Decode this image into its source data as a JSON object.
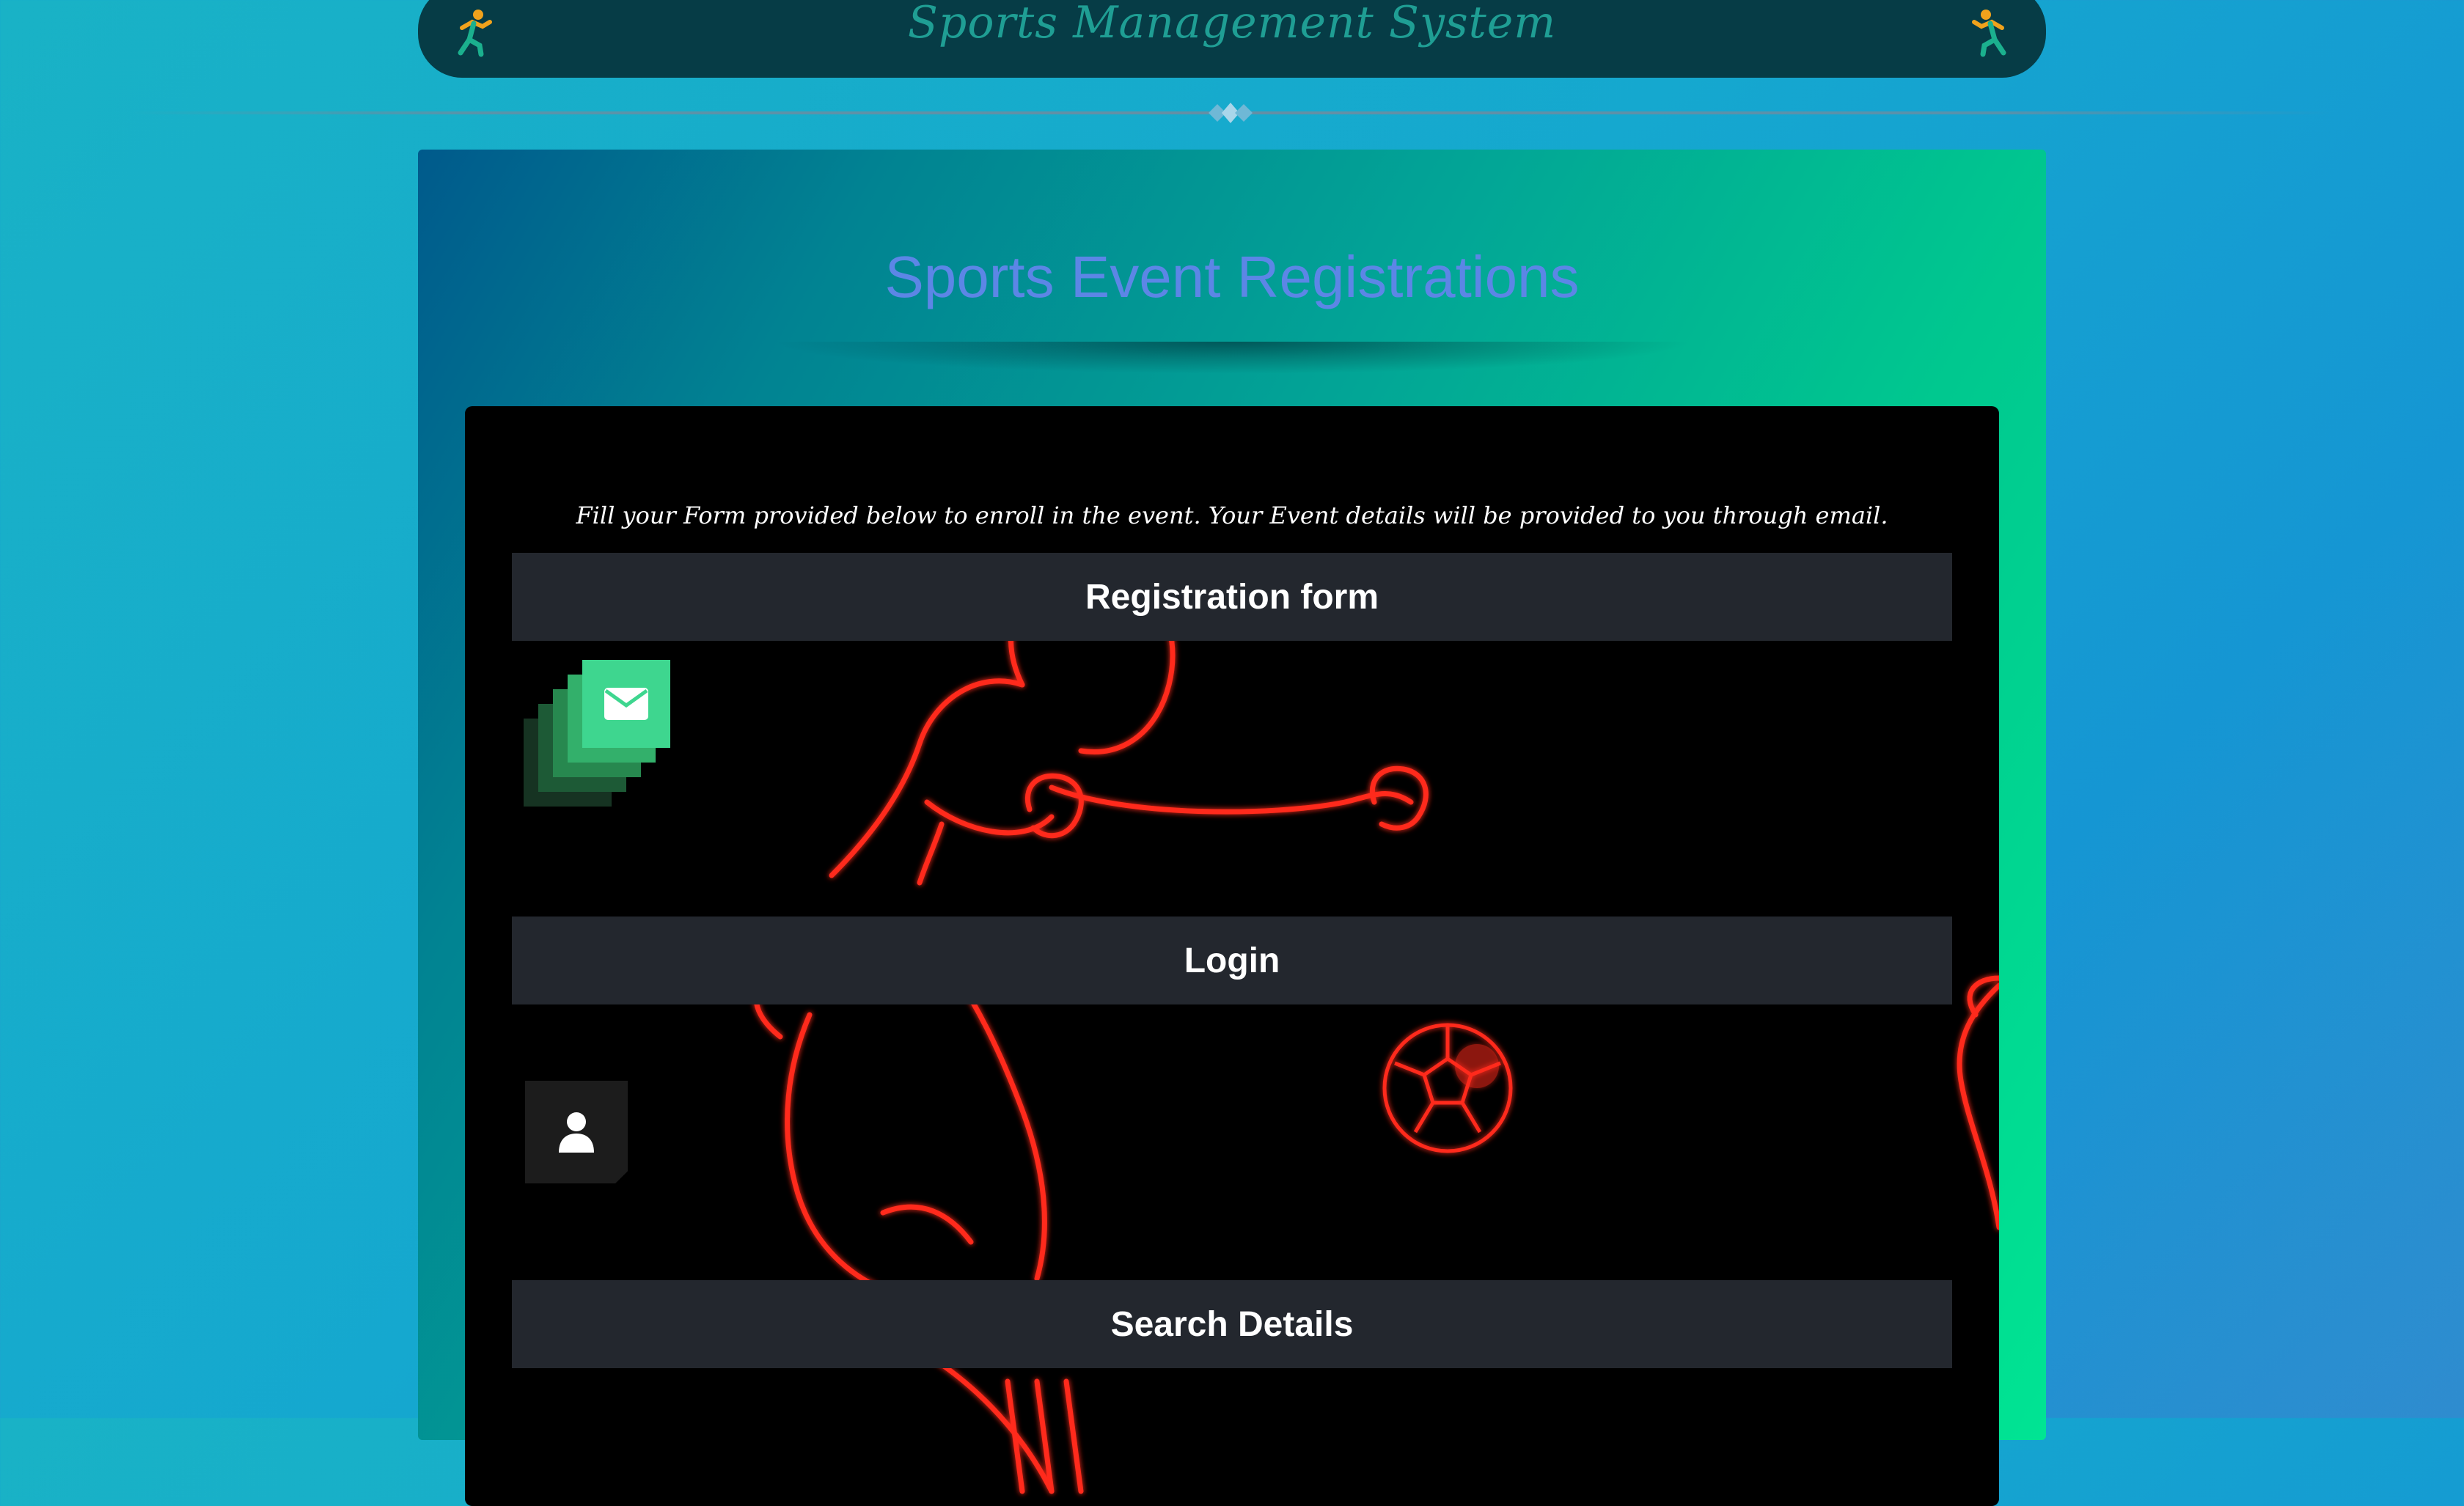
{
  "header": {
    "site_title": "Sports Management System",
    "left_icon": "runner-icon",
    "right_icon": "runner-icon"
  },
  "panel": {
    "title": "Sports Event Registrations",
    "instruction": "Fill your Form provided below to enroll in the event. Your Event details will be provided to you through email.",
    "sections": [
      {
        "label": "Registration form",
        "icon": "envelope-icon"
      },
      {
        "label": "Login",
        "icon": "user-icon"
      },
      {
        "label": "Search Details"
      }
    ]
  },
  "colors": {
    "header_bg": "#063c46",
    "title_accent": "#5c86e6",
    "section_bar_bg": "#23272e",
    "mail_tile": "#3ed68f",
    "neon_red": "#ff2a1a"
  }
}
